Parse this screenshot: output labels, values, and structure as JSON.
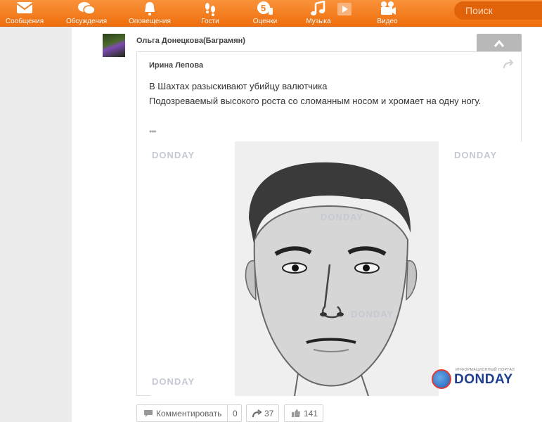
{
  "nav": {
    "items": [
      {
        "label": "Сообщения",
        "icon": "envelope-icon"
      },
      {
        "label": "Обсуждения",
        "icon": "chat-bubbles-icon"
      },
      {
        "label": "Оповещения",
        "icon": "bell-icon"
      },
      {
        "label": "Гости",
        "icon": "footprints-icon"
      },
      {
        "label": "Оценки",
        "icon": "rating-five-icon"
      },
      {
        "label": "Музыка",
        "icon": "music-note-icon"
      },
      {
        "label": "Видео",
        "icon": "video-camera-icon"
      }
    ],
    "search_placeholder": "Поиск"
  },
  "post": {
    "author": "Ольга Донецкова(Баграмян)",
    "repost": {
      "author": "Ирина Лепова",
      "text_lines": [
        "В Шахтах разыскивают убийцу валютчика",
        "Подозреваемый высокого роста со сломанным носом и хромает на одну ногу."
      ],
      "more": "•••",
      "image": {
        "watermark": "DONDAY",
        "logo_tagline": "информационный портал",
        "logo_text": "DONDAY"
      }
    },
    "actions": {
      "comment_label": "Комментировать",
      "comment_count": "0",
      "share_count": "37",
      "like_count": "141"
    }
  },
  "colors": {
    "toolbar": "#f07f1f",
    "text": "#333333",
    "logo_blue": "#1d3f8c"
  }
}
